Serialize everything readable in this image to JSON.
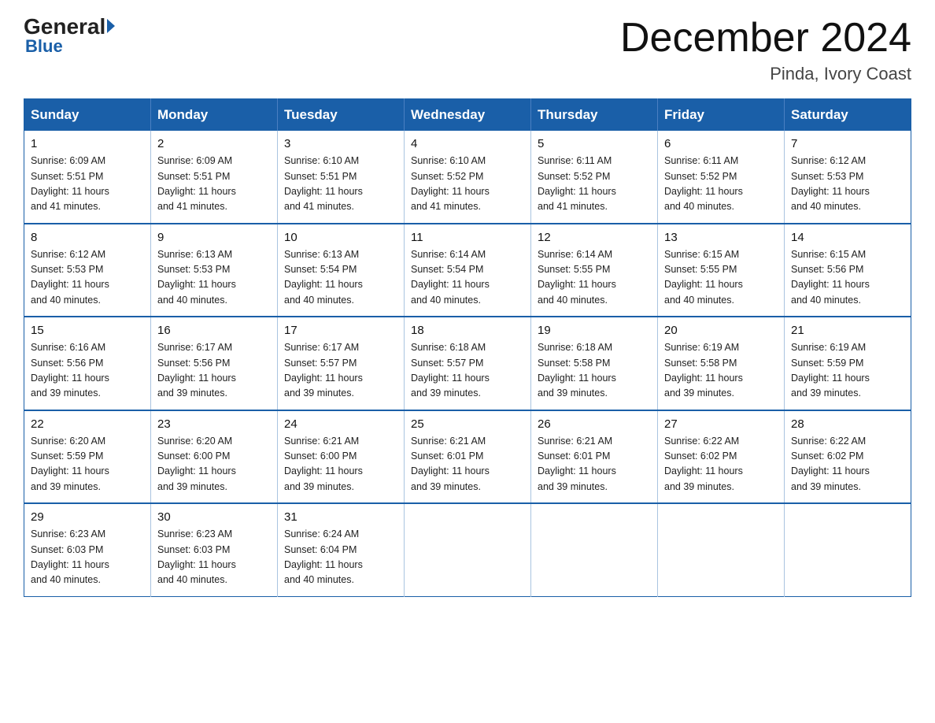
{
  "logo": {
    "general": "General",
    "arrow": "▶",
    "blue": "Blue"
  },
  "header": {
    "month_title": "December 2024",
    "location": "Pinda, Ivory Coast"
  },
  "days_of_week": [
    "Sunday",
    "Monday",
    "Tuesday",
    "Wednesday",
    "Thursday",
    "Friday",
    "Saturday"
  ],
  "weeks": [
    [
      {
        "day": "1",
        "info": "Sunrise: 6:09 AM\nSunset: 5:51 PM\nDaylight: 11 hours\nand 41 minutes."
      },
      {
        "day": "2",
        "info": "Sunrise: 6:09 AM\nSunset: 5:51 PM\nDaylight: 11 hours\nand 41 minutes."
      },
      {
        "day": "3",
        "info": "Sunrise: 6:10 AM\nSunset: 5:51 PM\nDaylight: 11 hours\nand 41 minutes."
      },
      {
        "day": "4",
        "info": "Sunrise: 6:10 AM\nSunset: 5:52 PM\nDaylight: 11 hours\nand 41 minutes."
      },
      {
        "day": "5",
        "info": "Sunrise: 6:11 AM\nSunset: 5:52 PM\nDaylight: 11 hours\nand 41 minutes."
      },
      {
        "day": "6",
        "info": "Sunrise: 6:11 AM\nSunset: 5:52 PM\nDaylight: 11 hours\nand 40 minutes."
      },
      {
        "day": "7",
        "info": "Sunrise: 6:12 AM\nSunset: 5:53 PM\nDaylight: 11 hours\nand 40 minutes."
      }
    ],
    [
      {
        "day": "8",
        "info": "Sunrise: 6:12 AM\nSunset: 5:53 PM\nDaylight: 11 hours\nand 40 minutes."
      },
      {
        "day": "9",
        "info": "Sunrise: 6:13 AM\nSunset: 5:53 PM\nDaylight: 11 hours\nand 40 minutes."
      },
      {
        "day": "10",
        "info": "Sunrise: 6:13 AM\nSunset: 5:54 PM\nDaylight: 11 hours\nand 40 minutes."
      },
      {
        "day": "11",
        "info": "Sunrise: 6:14 AM\nSunset: 5:54 PM\nDaylight: 11 hours\nand 40 minutes."
      },
      {
        "day": "12",
        "info": "Sunrise: 6:14 AM\nSunset: 5:55 PM\nDaylight: 11 hours\nand 40 minutes."
      },
      {
        "day": "13",
        "info": "Sunrise: 6:15 AM\nSunset: 5:55 PM\nDaylight: 11 hours\nand 40 minutes."
      },
      {
        "day": "14",
        "info": "Sunrise: 6:15 AM\nSunset: 5:56 PM\nDaylight: 11 hours\nand 40 minutes."
      }
    ],
    [
      {
        "day": "15",
        "info": "Sunrise: 6:16 AM\nSunset: 5:56 PM\nDaylight: 11 hours\nand 39 minutes."
      },
      {
        "day": "16",
        "info": "Sunrise: 6:17 AM\nSunset: 5:56 PM\nDaylight: 11 hours\nand 39 minutes."
      },
      {
        "day": "17",
        "info": "Sunrise: 6:17 AM\nSunset: 5:57 PM\nDaylight: 11 hours\nand 39 minutes."
      },
      {
        "day": "18",
        "info": "Sunrise: 6:18 AM\nSunset: 5:57 PM\nDaylight: 11 hours\nand 39 minutes."
      },
      {
        "day": "19",
        "info": "Sunrise: 6:18 AM\nSunset: 5:58 PM\nDaylight: 11 hours\nand 39 minutes."
      },
      {
        "day": "20",
        "info": "Sunrise: 6:19 AM\nSunset: 5:58 PM\nDaylight: 11 hours\nand 39 minutes."
      },
      {
        "day": "21",
        "info": "Sunrise: 6:19 AM\nSunset: 5:59 PM\nDaylight: 11 hours\nand 39 minutes."
      }
    ],
    [
      {
        "day": "22",
        "info": "Sunrise: 6:20 AM\nSunset: 5:59 PM\nDaylight: 11 hours\nand 39 minutes."
      },
      {
        "day": "23",
        "info": "Sunrise: 6:20 AM\nSunset: 6:00 PM\nDaylight: 11 hours\nand 39 minutes."
      },
      {
        "day": "24",
        "info": "Sunrise: 6:21 AM\nSunset: 6:00 PM\nDaylight: 11 hours\nand 39 minutes."
      },
      {
        "day": "25",
        "info": "Sunrise: 6:21 AM\nSunset: 6:01 PM\nDaylight: 11 hours\nand 39 minutes."
      },
      {
        "day": "26",
        "info": "Sunrise: 6:21 AM\nSunset: 6:01 PM\nDaylight: 11 hours\nand 39 minutes."
      },
      {
        "day": "27",
        "info": "Sunrise: 6:22 AM\nSunset: 6:02 PM\nDaylight: 11 hours\nand 39 minutes."
      },
      {
        "day": "28",
        "info": "Sunrise: 6:22 AM\nSunset: 6:02 PM\nDaylight: 11 hours\nand 39 minutes."
      }
    ],
    [
      {
        "day": "29",
        "info": "Sunrise: 6:23 AM\nSunset: 6:03 PM\nDaylight: 11 hours\nand 40 minutes."
      },
      {
        "day": "30",
        "info": "Sunrise: 6:23 AM\nSunset: 6:03 PM\nDaylight: 11 hours\nand 40 minutes."
      },
      {
        "day": "31",
        "info": "Sunrise: 6:24 AM\nSunset: 6:04 PM\nDaylight: 11 hours\nand 40 minutes."
      },
      {
        "day": "",
        "info": ""
      },
      {
        "day": "",
        "info": ""
      },
      {
        "day": "",
        "info": ""
      },
      {
        "day": "",
        "info": ""
      }
    ]
  ]
}
